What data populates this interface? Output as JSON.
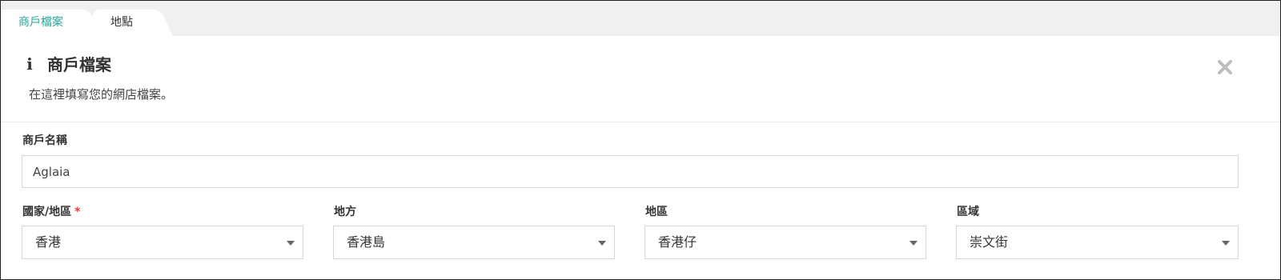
{
  "tabs": [
    {
      "label": "商戶檔案",
      "active": true
    },
    {
      "label": "地點",
      "active": false
    }
  ],
  "header": {
    "icon": "info-icon",
    "title": "商戶檔案",
    "subtitle": "在這裡填寫您的網店檔案。",
    "close_icon": "close-icon"
  },
  "form": {
    "merchant_name": {
      "label": "商戶名稱",
      "value": "Aglaia"
    },
    "country": {
      "label": "國家/地區",
      "required_mark": "*",
      "value": "香港"
    },
    "locality": {
      "label": "地方",
      "value": "香港島"
    },
    "district": {
      "label": "地區",
      "value": "香港仔"
    },
    "area": {
      "label": "區域",
      "value": "崇文街"
    }
  },
  "colors": {
    "accent": "#26a69a",
    "required": "#e53935",
    "tabbar_bg": "#f0f0f0",
    "border": "#d6d6d6"
  }
}
